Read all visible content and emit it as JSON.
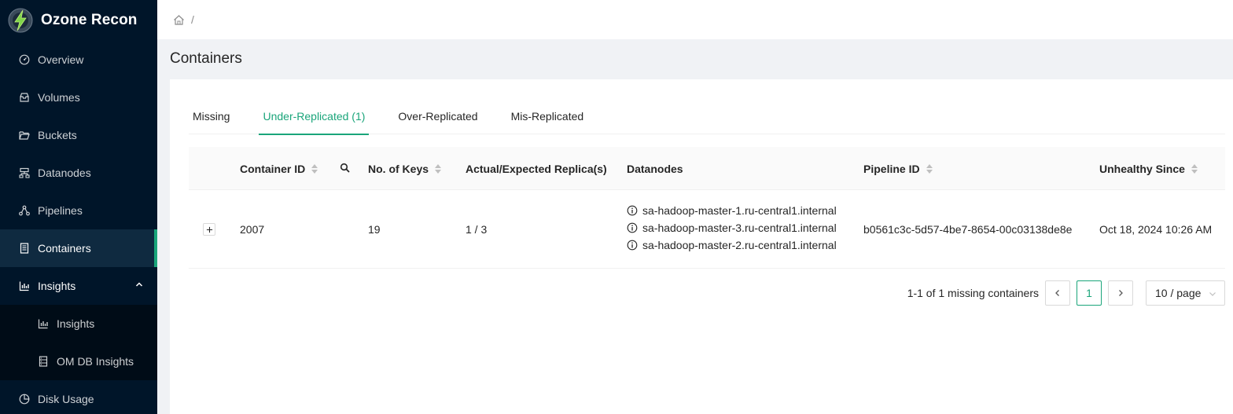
{
  "app": {
    "title": "Ozone Recon"
  },
  "sidebar": {
    "items": [
      {
        "label": "Overview",
        "icon": "dashboard-icon"
      },
      {
        "label": "Volumes",
        "icon": "inbox-icon"
      },
      {
        "label": "Buckets",
        "icon": "folder-open-icon"
      },
      {
        "label": "Datanodes",
        "icon": "cluster-icon"
      },
      {
        "label": "Pipelines",
        "icon": "deployment-unit-icon"
      },
      {
        "label": "Containers",
        "icon": "container-icon"
      },
      {
        "label": "Insights",
        "icon": "bar-chart-icon"
      },
      {
        "label": "Disk Usage",
        "icon": "pie-chart-icon"
      }
    ],
    "submenu": [
      {
        "label": "Insights",
        "icon": "bar-chart-icon"
      },
      {
        "label": "OM DB Insights",
        "icon": "database-icon"
      }
    ]
  },
  "header": {
    "breadcrumb_sep": "/"
  },
  "page": {
    "title": "Containers"
  },
  "tabs": [
    {
      "label": "Missing"
    },
    {
      "label": "Under-Replicated (1)"
    },
    {
      "label": "Over-Replicated"
    },
    {
      "label": "Mis-Replicated"
    }
  ],
  "table": {
    "columns": {
      "container_id": "Container ID",
      "num_keys": "No. of Keys",
      "replicas": "Actual/Expected Replica(s)",
      "datanodes": "Datanodes",
      "pipeline_id": "Pipeline ID",
      "unhealthy_since": "Unhealthy Since"
    },
    "rows": [
      {
        "expand": "+",
        "container_id": "2007",
        "num_keys": "19",
        "replicas": "1 / 3",
        "datanodes": [
          "sa-hadoop-master-1.ru-central1.internal",
          "sa-hadoop-master-3.ru-central1.internal",
          "sa-hadoop-master-2.ru-central1.internal"
        ],
        "pipeline_id": "b0561c3c-5d57-4be7-8654-00c03138de8e",
        "unhealthy_since": "Oct 18, 2024 10:26 AM"
      }
    ]
  },
  "pagination": {
    "total_text": "1-1 of 1 missing containers",
    "current_page": "1",
    "page_size": "10 / page"
  },
  "colors": {
    "accent": "#1aa57a",
    "sidebar_bg": "#001529"
  }
}
